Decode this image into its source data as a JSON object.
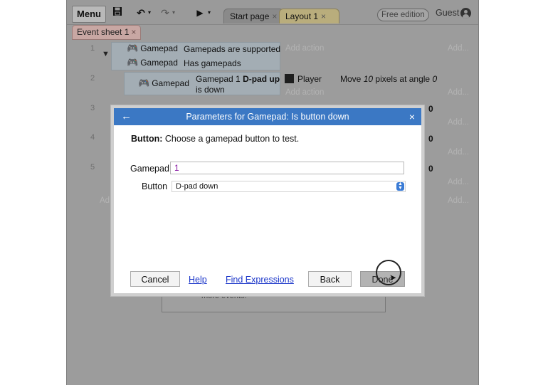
{
  "toolbar": {
    "menu_label": "Menu",
    "tabs": [
      {
        "label": "Start page",
        "close": "×"
      },
      {
        "label": "Layout 1",
        "close": "×"
      }
    ],
    "free_edition": "Free edition",
    "user": "Guest"
  },
  "event_sheet_tab": {
    "label": "Event sheet 1",
    "close": "×"
  },
  "events": {
    "rows": [
      {
        "num": "1"
      },
      {
        "num": "2"
      },
      {
        "num": "3"
      },
      {
        "num": "4"
      },
      {
        "num": "5"
      }
    ],
    "e1": {
      "c1_obj": "Gamepad",
      "c1_text": "Gamepads are supported",
      "c2_obj": "Gamepad",
      "c2_text": "Has gamepads",
      "add_action": "Add action",
      "add_more": "Add..."
    },
    "e2": {
      "cond_obj": "Gamepad",
      "cond_pre": "Gamepad 1",
      "cond_bold": "D-pad up",
      "cond_post": "is down",
      "action_obj": "Player",
      "action_pre": "Move",
      "action_num": "10",
      "action_mid": "pixels at angle",
      "action_angle": "0",
      "add_action": "Add action",
      "add_more": "Add..."
    },
    "r3_angle": "0",
    "r4_angle": "0",
    "r5_angle": "0",
    "r3_add_more": "Add...",
    "r4_add_more": "Add...",
    "r5_add_more": "Add...",
    "bottom_add_left": "Ad",
    "bottom_add_more": "Add...",
    "bg_more_events": "more events."
  },
  "dialog": {
    "title": "Parameters for Gamepad: Is button down",
    "back_icon": "←",
    "close_icon": "×",
    "desc_label": "Button:",
    "desc_text": "Choose a gamepad button to test.",
    "gamepad_label": "Gamepad",
    "gamepad_value": "1",
    "button_label": "Button",
    "button_value": "D-pad down",
    "cancel": "Cancel",
    "help": "Help",
    "find_expressions": "Find Expressions",
    "back": "Back",
    "done": "Done"
  }
}
